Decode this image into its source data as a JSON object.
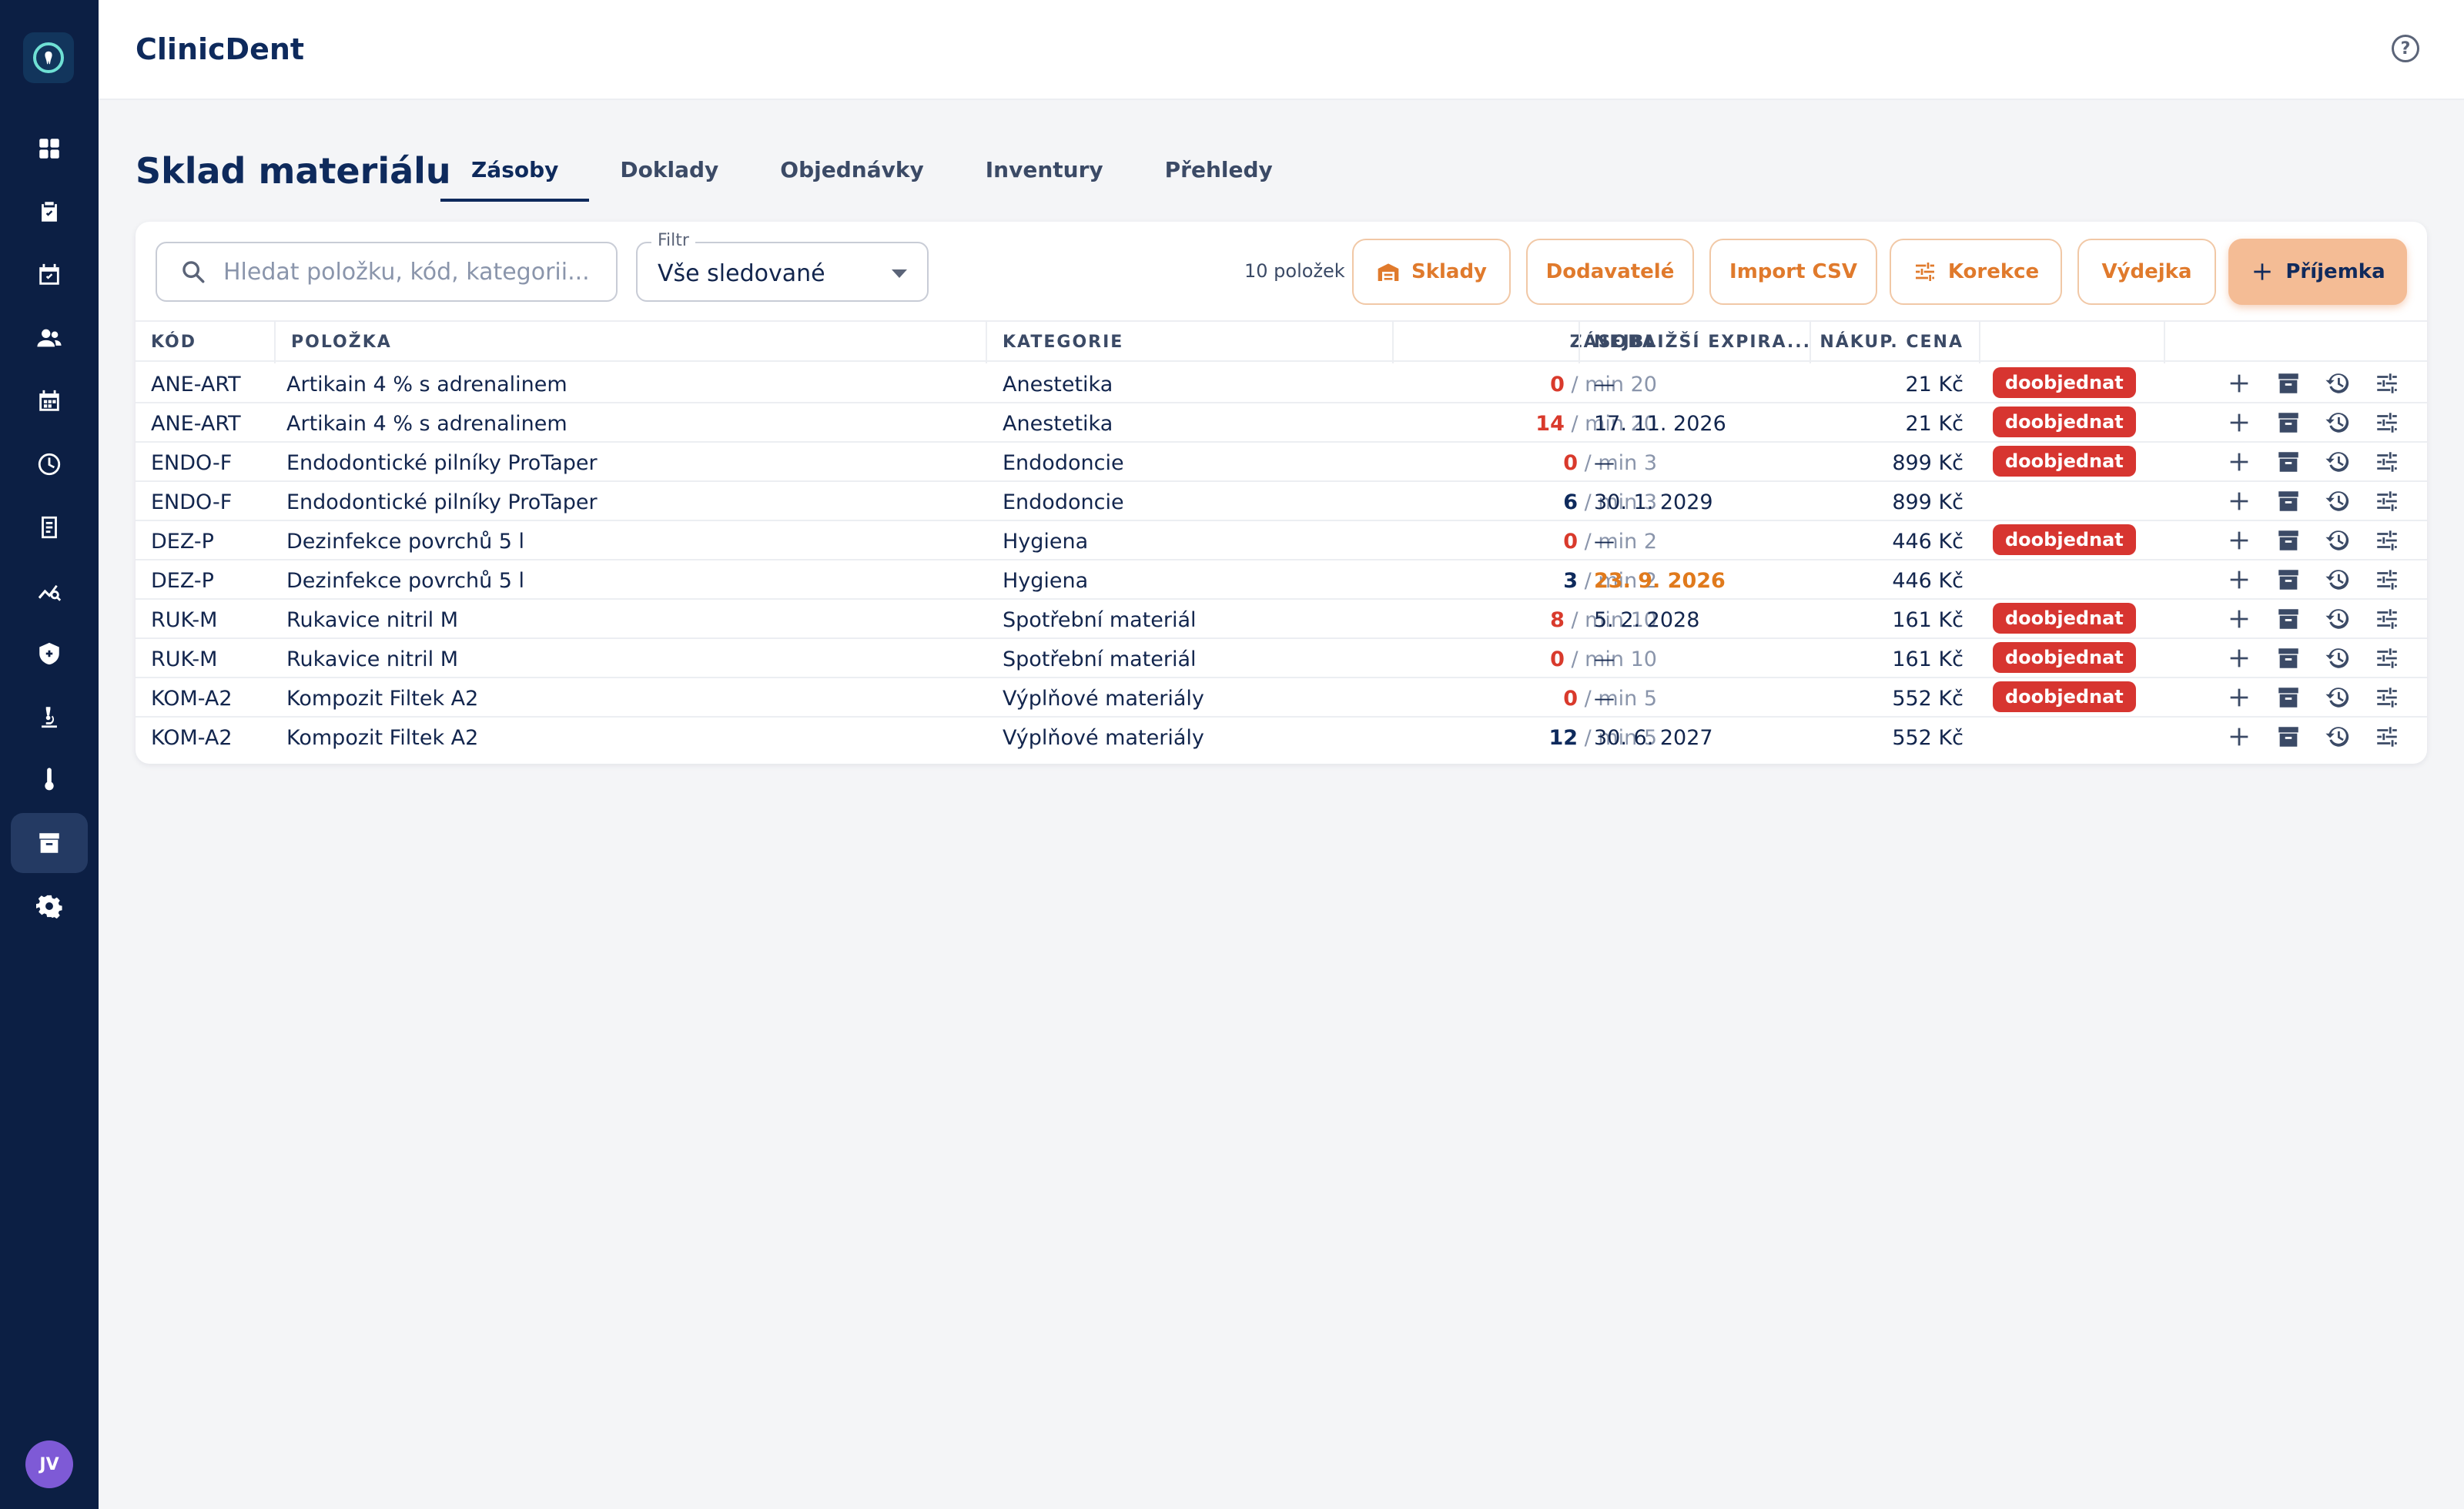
{
  "app": {
    "title": "ClinicDent"
  },
  "user": {
    "initials": "JV"
  },
  "page": {
    "title": "Sklad materiálu"
  },
  "tabs": [
    {
      "label": "Zásoby",
      "active": true
    },
    {
      "label": "Doklady",
      "active": false
    },
    {
      "label": "Objednávky",
      "active": false
    },
    {
      "label": "Inventury",
      "active": false
    },
    {
      "label": "Přehledy",
      "active": false
    }
  ],
  "toolbar": {
    "search_placeholder": "Hledat položku, kód, kategorii...",
    "filter_label": "Filtr",
    "filter_value": "Vše sledované",
    "count": "10 položek",
    "btn_warehouses": "Sklady",
    "btn_suppliers": "Dodavatelé",
    "btn_import": "Import CSV",
    "btn_correction": "Korekce",
    "btn_issue": "Výdejka",
    "btn_receipt": "Příjemka"
  },
  "table": {
    "headers": {
      "code": "KÓD",
      "item": "POLOŽKA",
      "category": "KATEGORIE",
      "stock": "ZÁSOBA",
      "expiry": "NEJBLIŽŠÍ EXPIRA...",
      "price": "NÁKUP. CENA"
    },
    "rows": [
      {
        "code": "ANE-ART",
        "item": "Artikain 4 % s adrenalinem",
        "category": "Anestetika",
        "qty": "0",
        "min": "/ min 20",
        "low": true,
        "expiry": "—",
        "expiry_warn": false,
        "price": "21 Kč",
        "badge": "doobjednat"
      },
      {
        "code": "ANE-ART",
        "item": "Artikain 4 % s adrenalinem",
        "category": "Anestetika",
        "qty": "14",
        "min": "/ min 20",
        "low": true,
        "expiry": "17. 11. 2026",
        "expiry_warn": false,
        "price": "21 Kč",
        "badge": "doobjednat"
      },
      {
        "code": "ENDO-F",
        "item": "Endodontické pilníky ProTaper",
        "category": "Endodoncie",
        "qty": "0",
        "min": "/ min 3",
        "low": true,
        "expiry": "—",
        "expiry_warn": false,
        "price": "899 Kč",
        "badge": "doobjednat"
      },
      {
        "code": "ENDO-F",
        "item": "Endodontické pilníky ProTaper",
        "category": "Endodoncie",
        "qty": "6",
        "min": "/ min 3",
        "low": false,
        "expiry": "30. 1. 2029",
        "expiry_warn": false,
        "price": "899 Kč",
        "badge": ""
      },
      {
        "code": "DEZ-P",
        "item": "Dezinfekce povrchů 5 l",
        "category": "Hygiena",
        "qty": "0",
        "min": "/ min 2",
        "low": true,
        "expiry": "—",
        "expiry_warn": false,
        "price": "446 Kč",
        "badge": "doobjednat"
      },
      {
        "code": "DEZ-P",
        "item": "Dezinfekce povrchů 5 l",
        "category": "Hygiena",
        "qty": "3",
        "min": "/ min 2",
        "low": false,
        "expiry": "23. 9. 2026",
        "expiry_warn": true,
        "price": "446 Kč",
        "badge": ""
      },
      {
        "code": "RUK-M",
        "item": "Rukavice nitril M",
        "category": "Spotřební materiál",
        "qty": "8",
        "min": "/ min 10",
        "low": true,
        "expiry": "5. 2. 2028",
        "expiry_warn": false,
        "price": "161 Kč",
        "badge": "doobjednat"
      },
      {
        "code": "RUK-M",
        "item": "Rukavice nitril M",
        "category": "Spotřební materiál",
        "qty": "0",
        "min": "/ min 10",
        "low": true,
        "expiry": "—",
        "expiry_warn": false,
        "price": "161 Kč",
        "badge": "doobjednat"
      },
      {
        "code": "KOM-A2",
        "item": "Kompozit Filtek A2",
        "category": "Výplňové materiály",
        "qty": "0",
        "min": "/ min 5",
        "low": true,
        "expiry": "—",
        "expiry_warn": false,
        "price": "552 Kč",
        "badge": "doobjednat"
      },
      {
        "code": "KOM-A2",
        "item": "Kompozit Filtek A2",
        "category": "Výplňové materiály",
        "qty": "12",
        "min": "/ min 5",
        "low": false,
        "expiry": "30. 6. 2027",
        "expiry_warn": false,
        "price": "552 Kč",
        "badge": ""
      }
    ]
  },
  "colors": {
    "sidebar": "#0c1f44",
    "accent": "#e07a2c",
    "danger": "#d73530",
    "warning": "#e07a1c",
    "navy": "#0e2a5c"
  },
  "icons": {
    "sidebar": [
      "dashboard-icon",
      "clipboard-check-icon",
      "calendar-check-icon",
      "patients-icon",
      "calendar-icon",
      "clock-icon",
      "ledger-icon",
      "analytics-icon",
      "shield-icon",
      "microscope-icon",
      "thermometer-icon",
      "archive-icon",
      "gear-icon"
    ],
    "row_actions": [
      "plus-icon",
      "archive-icon",
      "history-icon",
      "sliders-icon"
    ]
  }
}
